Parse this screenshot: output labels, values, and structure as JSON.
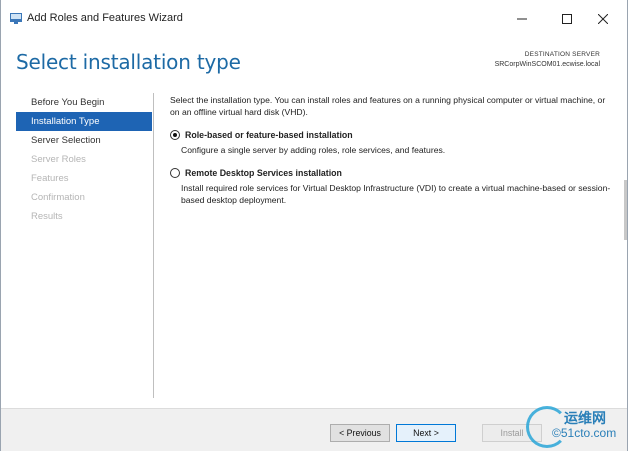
{
  "window": {
    "title": "Add Roles and Features Wizard",
    "minimize": "—",
    "maximize": "☐",
    "close": "✕"
  },
  "header": {
    "title": "Select installation type",
    "destination_label": "DESTINATION SERVER",
    "destination_server": "SRCorpWinSCOM01.ecwise.local"
  },
  "nav": {
    "items": [
      {
        "label": "Before You Begin",
        "state": "normal"
      },
      {
        "label": "Installation Type",
        "state": "active"
      },
      {
        "label": "Server Selection",
        "state": "normal"
      },
      {
        "label": "Server Roles",
        "state": "disabled"
      },
      {
        "label": "Features",
        "state": "disabled"
      },
      {
        "label": "Confirmation",
        "state": "disabled"
      },
      {
        "label": "Results",
        "state": "disabled"
      }
    ]
  },
  "content": {
    "intro": "Select the installation type. You can install roles and features on a running physical computer or virtual machine, or on an offline virtual hard disk (VHD).",
    "options": [
      {
        "label": "Role-based or feature-based installation",
        "description": "Configure a single server by adding roles, role services, and features.",
        "checked": true
      },
      {
        "label": "Remote Desktop Services installation",
        "description": "Install required role services for Virtual Desktop Infrastructure (VDI) to create a virtual machine-based or session-based desktop deployment.",
        "checked": false
      }
    ]
  },
  "footer": {
    "previous": "< Previous",
    "next": "Next >",
    "install": "Install"
  },
  "watermark": {
    "line1": "运维网",
    "line2": "©51cto.com"
  },
  "colors": {
    "accent": "#1e64b4",
    "title": "#1d6aa5",
    "disabled": "#b5b5b5"
  }
}
